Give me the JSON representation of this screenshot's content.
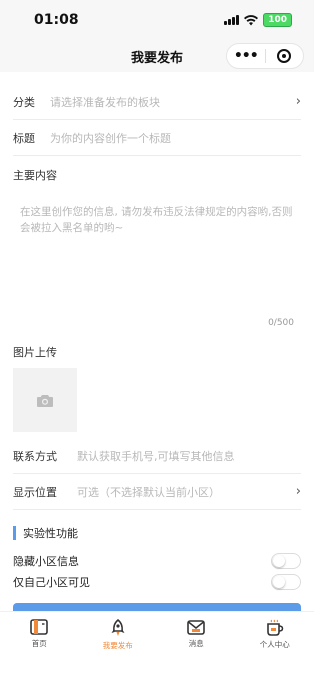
{
  "status": {
    "time": "01:08",
    "battery": "100"
  },
  "nav": {
    "title": "我要发布"
  },
  "form": {
    "category_label": "分类",
    "category_placeholder": "请选择准备发布的板块",
    "title_label": "标题",
    "title_placeholder": "为你的内容创作一个标题",
    "content_label": "主要内容",
    "content_placeholder": "在这里创作您的信息, 请勿发布违反法律规定的内容哟,否则会被拉入黑名单的哟~",
    "counter": "0/500",
    "image_label": "图片上传",
    "contact_label": "联系方式",
    "contact_placeholder": "默认获取手机号,可填写其他信息",
    "location_label": "显示位置",
    "location_placeholder": "可选（不选择默认当前小区）"
  },
  "experimental": {
    "title": "实验性功能",
    "toggles": [
      {
        "label": "隐藏小区信息"
      },
      {
        "label": "仅自己小区可见"
      }
    ]
  },
  "tabs": [
    {
      "label": "首页",
      "icon": "home-icon"
    },
    {
      "label": "我要发布",
      "icon": "rocket-icon"
    },
    {
      "label": "消息",
      "icon": "mail-icon"
    },
    {
      "label": "个人中心",
      "icon": "user-cup-icon"
    }
  ],
  "colors": {
    "accent": "#5b9be8",
    "active_tab": "#f08a3a",
    "battery": "#4cd964"
  }
}
